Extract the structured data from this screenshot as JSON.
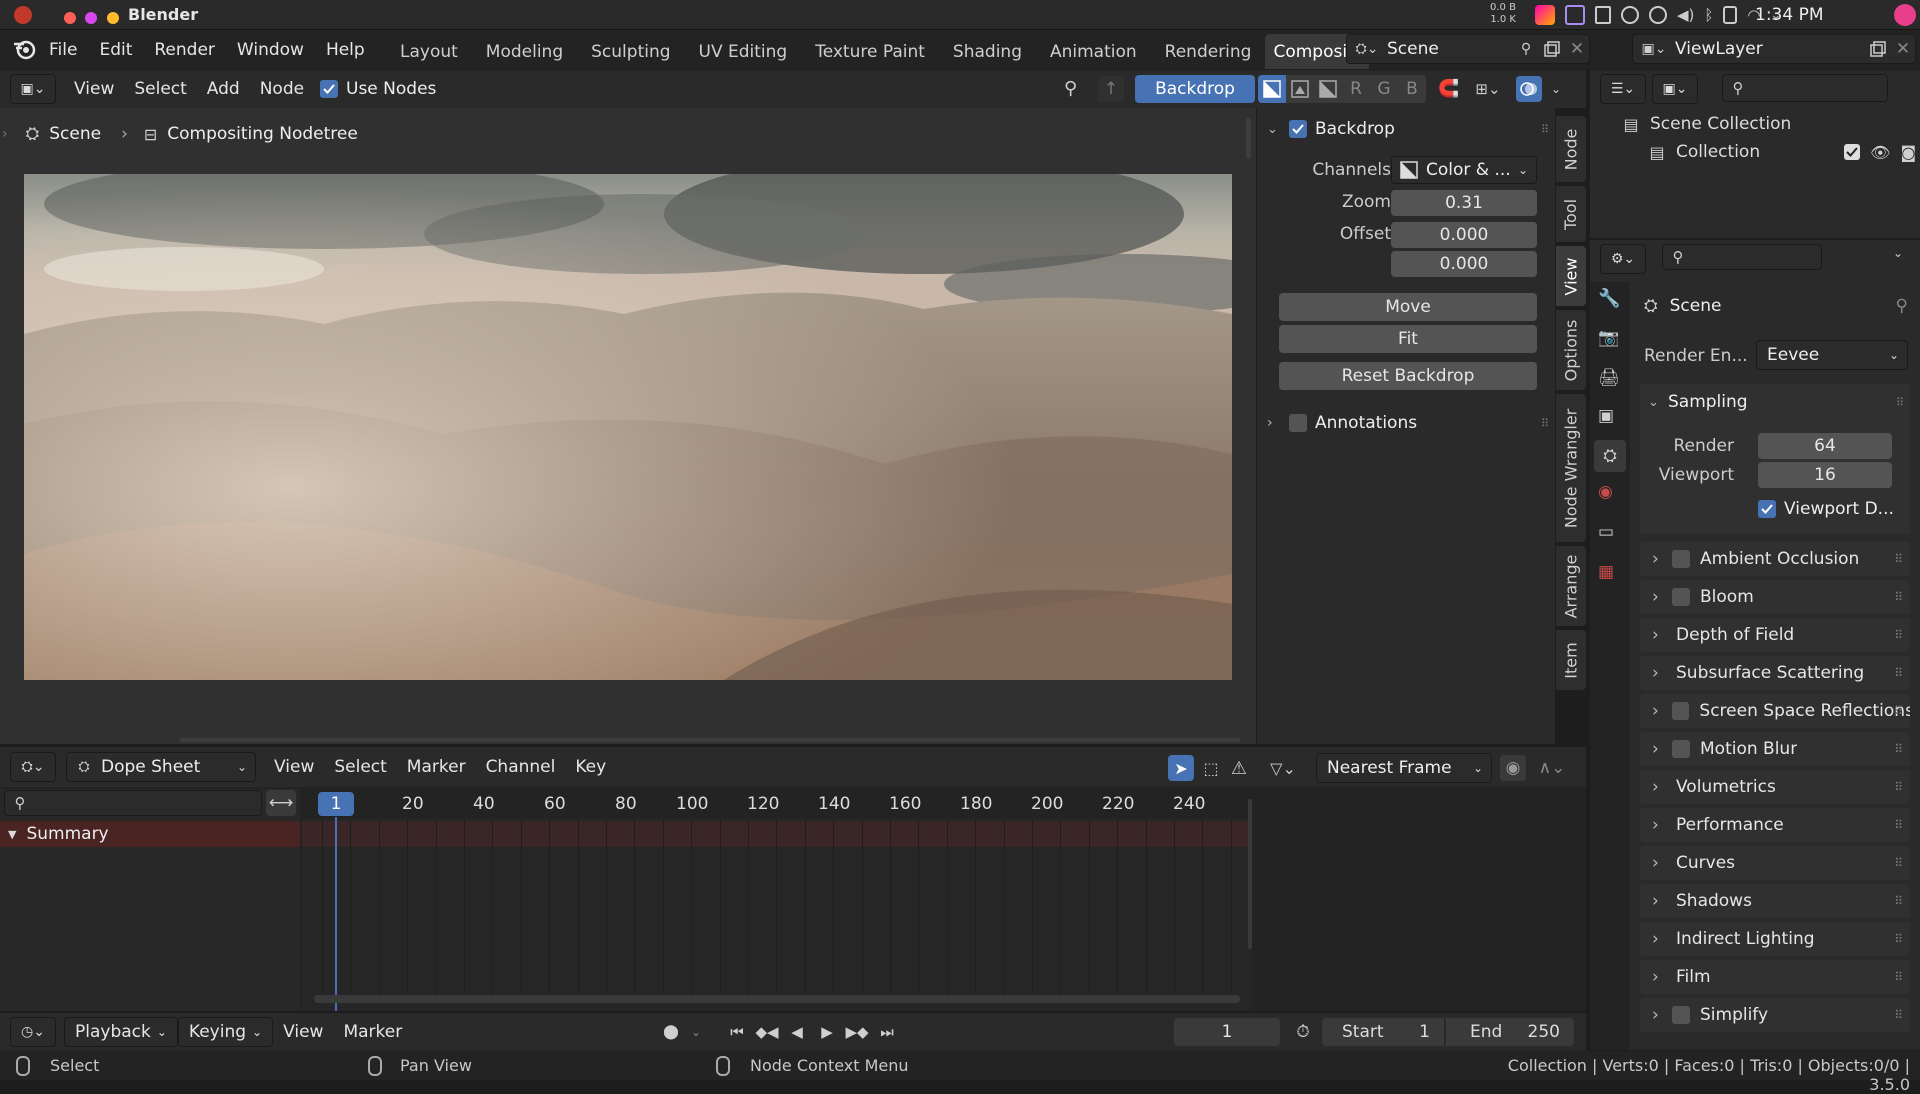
{
  "system": {
    "app_name": "Blender",
    "net_up": "0.0 B",
    "net_down": "1.0 K",
    "clock": "1:34 PM"
  },
  "menubar": {
    "menus": [
      "File",
      "Edit",
      "Render",
      "Window",
      "Help"
    ],
    "workspaces": [
      "Layout",
      "Modeling",
      "Sculpting",
      "UV Editing",
      "Texture Paint",
      "Shading",
      "Animation",
      "Rendering",
      "Compositin"
    ],
    "active_workspace": "Compositin",
    "scene": "Scene",
    "view_layer": "ViewLayer"
  },
  "node_header": {
    "menus": [
      "View",
      "Select",
      "Add",
      "Node"
    ],
    "use_nodes_label": "Use Nodes",
    "use_nodes_checked": true,
    "backdrop_button": "Backdrop",
    "channel_letters": [
      "R",
      "G",
      "B"
    ]
  },
  "breadcrumb": {
    "scene": "Scene",
    "nodetree": "Compositing Nodetree"
  },
  "npanel": {
    "backdrop_header": "Backdrop",
    "channels_label": "Channels",
    "channels_value": "Color & ...",
    "zoom_label": "Zoom",
    "zoom_value": "0.31",
    "offset_label": "Offset",
    "offset_x": "0.000",
    "offset_y": "0.000",
    "move_button": "Move",
    "fit_button": "Fit",
    "reset_button": "Reset Backdrop",
    "annotations_header": "Annotations",
    "tabs": [
      "Node",
      "Tool",
      "View",
      "Options",
      "Node Wrangler",
      "Arrange",
      "Item"
    ],
    "active_tab": "View"
  },
  "dopesheet": {
    "editor_type": "Dope Sheet",
    "menus": [
      "View",
      "Select",
      "Marker",
      "Channel",
      "Key"
    ],
    "snap_mode": "Nearest Frame",
    "current_frame_label": "1",
    "ruler": [
      "20",
      "40",
      "60",
      "80",
      "100",
      "120",
      "140",
      "160",
      "180",
      "200",
      "220",
      "240"
    ],
    "summary_label": "Summary"
  },
  "timeline": {
    "menus": [
      "Playback",
      "Keying",
      "View",
      "Marker"
    ],
    "current_frame": "1",
    "start_label": "Start",
    "start_value": "1",
    "end_label": "End",
    "end_value": "250"
  },
  "status": {
    "select": "Select",
    "pan": "Pan View",
    "context": "Node Context Menu",
    "stats": "Collection | Verts:0 | Faces:0 | Tris:0 | Objects:0/0 | 3.5.0"
  },
  "outliner": {
    "root": "Scene Collection",
    "child": "Collection"
  },
  "properties": {
    "context": "Scene",
    "render_engine_label": "Render En...",
    "render_engine_value": "Eevee",
    "sampling_header": "Sampling",
    "render_label": "Render",
    "render_value": "64",
    "viewport_label": "Viewport",
    "viewport_value": "16",
    "viewport_denoise_label": "Viewport D...",
    "sections": [
      {
        "label": "Ambient Occlusion",
        "checkbox": true
      },
      {
        "label": "Bloom",
        "checkbox": true
      },
      {
        "label": "Depth of Field",
        "checkbox": false
      },
      {
        "label": "Subsurface Scattering",
        "checkbox": false
      },
      {
        "label": "Screen Space Reflections",
        "checkbox": true
      },
      {
        "label": "Motion Blur",
        "checkbox": true
      },
      {
        "label": "Volumetrics",
        "checkbox": false
      },
      {
        "label": "Performance",
        "checkbox": false
      },
      {
        "label": "Curves",
        "checkbox": false
      },
      {
        "label": "Shadows",
        "checkbox": false
      },
      {
        "label": "Indirect Lighting",
        "checkbox": false
      },
      {
        "label": "Film",
        "checkbox": false
      },
      {
        "label": "Simplify",
        "checkbox": true
      }
    ]
  },
  "colors": {
    "accent": "#4772b3",
    "playhead": "#4772b3",
    "summary_bg": "#4a2323"
  }
}
